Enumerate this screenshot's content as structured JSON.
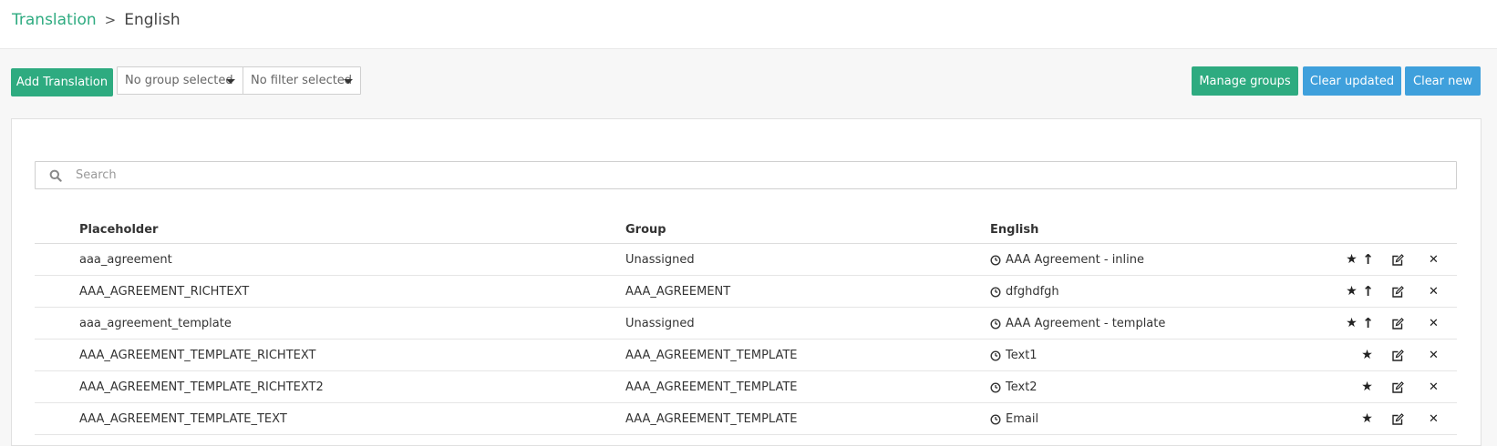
{
  "breadcrumb": {
    "parent": "Translation",
    "separator": ">",
    "current": "English"
  },
  "toolbar": {
    "add_label": "Add Translation",
    "group_select": "No group selected",
    "filter_select": "No filter selected",
    "manage_groups_label": "Manage groups",
    "clear_updated_label": "Clear updated",
    "clear_new_label": "Clear new"
  },
  "search": {
    "placeholder": "Search",
    "value": "",
    "icon": "search-icon"
  },
  "table": {
    "headers": {
      "placeholder": "Placeholder",
      "group": "Group",
      "english": "English"
    },
    "rows": [
      {
        "placeholder": "aaa_agreement",
        "group": "Unassigned",
        "english": "AAA Agreement - inline",
        "up": true
      },
      {
        "placeholder": "AAA_AGREEMENT_RICHTEXT",
        "group": "AAA_AGREEMENT",
        "english": "dfghdfgh",
        "up": true
      },
      {
        "placeholder": "aaa_agreement_template",
        "group": "Unassigned",
        "english": "AAA Agreement - template",
        "up": true
      },
      {
        "placeholder": "AAA_AGREEMENT_TEMPLATE_RICHTEXT",
        "group": "AAA_AGREEMENT_TEMPLATE",
        "english": "Text1",
        "up": false
      },
      {
        "placeholder": "AAA_AGREEMENT_TEMPLATE_RICHTEXT2",
        "group": "AAA_AGREEMENT_TEMPLATE",
        "english": "Text2",
        "up": false
      },
      {
        "placeholder": "AAA_AGREEMENT_TEMPLATE_TEXT",
        "group": "AAA_AGREEMENT_TEMPLATE",
        "english": "Email",
        "up": false
      }
    ]
  },
  "colors": {
    "green": "#2eab80",
    "blue": "#3fa0dc"
  },
  "icons": [
    "search-icon",
    "clock-icon",
    "star-icon",
    "arrow-up-icon",
    "edit-icon",
    "delete-icon",
    "caret-down-icon"
  ]
}
